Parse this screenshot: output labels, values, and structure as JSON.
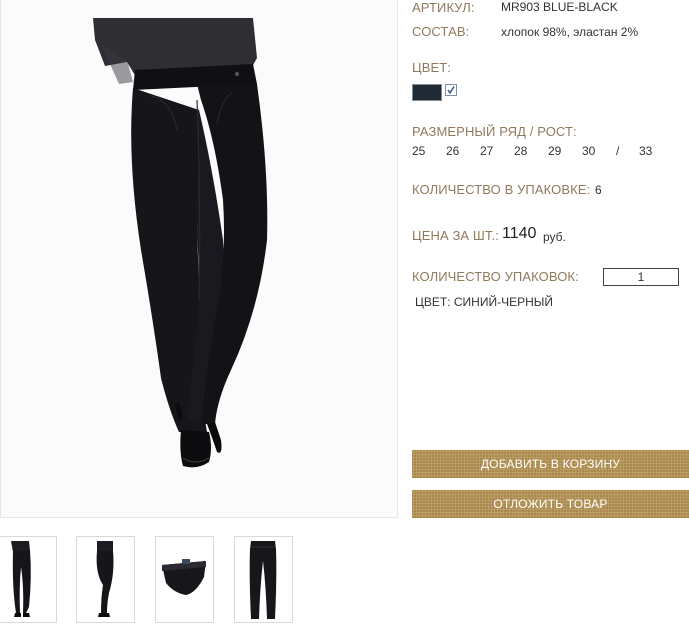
{
  "product": {
    "article_label": "АРТИКУЛ:",
    "article_value": "MR903 BLUE-BLACK",
    "composition_label": "СОСТАВ:",
    "composition_value": "хлопок 98%, эластан 2%",
    "color_label": "ЦВЕТ:",
    "color_swatch": "#202a34",
    "color_swatch_selected": true,
    "sizes_label": "РАЗМЕРНЫЙ РЯД / РОСТ:",
    "sizes": [
      "25",
      "26",
      "27",
      "28",
      "29",
      "30",
      "/",
      "33"
    ],
    "pack_qty_label": "КОЛИЧЕСТВО В УПАКОВКЕ:",
    "pack_qty_value": "6",
    "price_label": "ЦЕНА ЗА ШТ.:",
    "price_value": "1140",
    "price_currency": "руб.",
    "packs_label": "КОЛИЧЕСТВО УПАКОВОК:",
    "packs_value": "1",
    "color_text": "ЦВЕТ: СИНИЙ-ЧЕРНЫЙ"
  },
  "buttons": {
    "add_to_cart": "ДОБАВИТЬ В КОРЗИНУ",
    "postpone": "ОТЛОЖИТЬ ТОВАР"
  },
  "thumbnails": [
    {
      "name": "front-view",
      "icon": "jeans-front-thumbnail"
    },
    {
      "name": "side-view",
      "icon": "jeans-side-thumbnail"
    },
    {
      "name": "fabric-detail",
      "icon": "jeans-fold-thumbnail"
    },
    {
      "name": "flat-view",
      "icon": "jeans-flat-thumbnail"
    }
  ],
  "colors": {
    "label": "#8f7a5c",
    "button": "#a9894f",
    "jeans": "#15151a"
  }
}
